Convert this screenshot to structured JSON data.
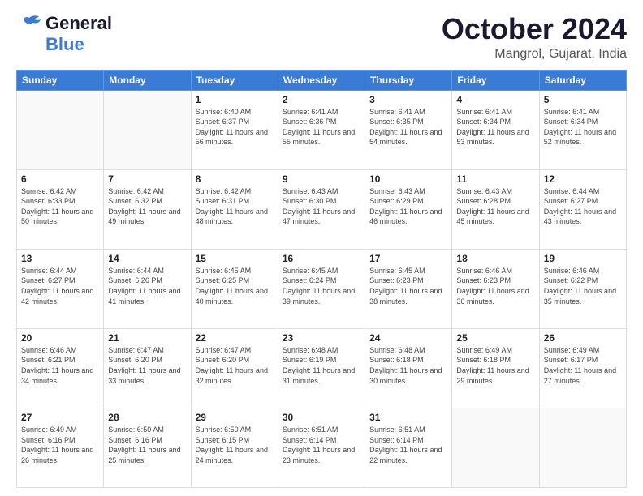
{
  "header": {
    "logo": {
      "line1": "General",
      "line2": "Blue"
    },
    "title": "October 2024",
    "location": "Mangrol, Gujarat, India"
  },
  "weekdays": [
    "Sunday",
    "Monday",
    "Tuesday",
    "Wednesday",
    "Thursday",
    "Friday",
    "Saturday"
  ],
  "weeks": [
    [
      {
        "day": "",
        "info": ""
      },
      {
        "day": "",
        "info": ""
      },
      {
        "day": "1",
        "sunrise": "6:40 AM",
        "sunset": "6:37 PM",
        "daylight": "11 hours and 56 minutes."
      },
      {
        "day": "2",
        "sunrise": "6:41 AM",
        "sunset": "6:36 PM",
        "daylight": "11 hours and 55 minutes."
      },
      {
        "day": "3",
        "sunrise": "6:41 AM",
        "sunset": "6:35 PM",
        "daylight": "11 hours and 54 minutes."
      },
      {
        "day": "4",
        "sunrise": "6:41 AM",
        "sunset": "6:34 PM",
        "daylight": "11 hours and 53 minutes."
      },
      {
        "day": "5",
        "sunrise": "6:41 AM",
        "sunset": "6:34 PM",
        "daylight": "11 hours and 52 minutes."
      }
    ],
    [
      {
        "day": "6",
        "sunrise": "6:42 AM",
        "sunset": "6:33 PM",
        "daylight": "11 hours and 50 minutes."
      },
      {
        "day": "7",
        "sunrise": "6:42 AM",
        "sunset": "6:32 PM",
        "daylight": "11 hours and 49 minutes."
      },
      {
        "day": "8",
        "sunrise": "6:42 AM",
        "sunset": "6:31 PM",
        "daylight": "11 hours and 48 minutes."
      },
      {
        "day": "9",
        "sunrise": "6:43 AM",
        "sunset": "6:30 PM",
        "daylight": "11 hours and 47 minutes."
      },
      {
        "day": "10",
        "sunrise": "6:43 AM",
        "sunset": "6:29 PM",
        "daylight": "11 hours and 46 minutes."
      },
      {
        "day": "11",
        "sunrise": "6:43 AM",
        "sunset": "6:28 PM",
        "daylight": "11 hours and 45 minutes."
      },
      {
        "day": "12",
        "sunrise": "6:44 AM",
        "sunset": "6:27 PM",
        "daylight": "11 hours and 43 minutes."
      }
    ],
    [
      {
        "day": "13",
        "sunrise": "6:44 AM",
        "sunset": "6:27 PM",
        "daylight": "11 hours and 42 minutes."
      },
      {
        "day": "14",
        "sunrise": "6:44 AM",
        "sunset": "6:26 PM",
        "daylight": "11 hours and 41 minutes."
      },
      {
        "day": "15",
        "sunrise": "6:45 AM",
        "sunset": "6:25 PM",
        "daylight": "11 hours and 40 minutes."
      },
      {
        "day": "16",
        "sunrise": "6:45 AM",
        "sunset": "6:24 PM",
        "daylight": "11 hours and 39 minutes."
      },
      {
        "day": "17",
        "sunrise": "6:45 AM",
        "sunset": "6:23 PM",
        "daylight": "11 hours and 38 minutes."
      },
      {
        "day": "18",
        "sunrise": "6:46 AM",
        "sunset": "6:23 PM",
        "daylight": "11 hours and 36 minutes."
      },
      {
        "day": "19",
        "sunrise": "6:46 AM",
        "sunset": "6:22 PM",
        "daylight": "11 hours and 35 minutes."
      }
    ],
    [
      {
        "day": "20",
        "sunrise": "6:46 AM",
        "sunset": "6:21 PM",
        "daylight": "11 hours and 34 minutes."
      },
      {
        "day": "21",
        "sunrise": "6:47 AM",
        "sunset": "6:20 PM",
        "daylight": "11 hours and 33 minutes."
      },
      {
        "day": "22",
        "sunrise": "6:47 AM",
        "sunset": "6:20 PM",
        "daylight": "11 hours and 32 minutes."
      },
      {
        "day": "23",
        "sunrise": "6:48 AM",
        "sunset": "6:19 PM",
        "daylight": "11 hours and 31 minutes."
      },
      {
        "day": "24",
        "sunrise": "6:48 AM",
        "sunset": "6:18 PM",
        "daylight": "11 hours and 30 minutes."
      },
      {
        "day": "25",
        "sunrise": "6:49 AM",
        "sunset": "6:18 PM",
        "daylight": "11 hours and 29 minutes."
      },
      {
        "day": "26",
        "sunrise": "6:49 AM",
        "sunset": "6:17 PM",
        "daylight": "11 hours and 27 minutes."
      }
    ],
    [
      {
        "day": "27",
        "sunrise": "6:49 AM",
        "sunset": "6:16 PM",
        "daylight": "11 hours and 26 minutes."
      },
      {
        "day": "28",
        "sunrise": "6:50 AM",
        "sunset": "6:16 PM",
        "daylight": "11 hours and 25 minutes."
      },
      {
        "day": "29",
        "sunrise": "6:50 AM",
        "sunset": "6:15 PM",
        "daylight": "11 hours and 24 minutes."
      },
      {
        "day": "30",
        "sunrise": "6:51 AM",
        "sunset": "6:14 PM",
        "daylight": "11 hours and 23 minutes."
      },
      {
        "day": "31",
        "sunrise": "6:51 AM",
        "sunset": "6:14 PM",
        "daylight": "11 hours and 22 minutes."
      },
      {
        "day": "",
        "info": ""
      },
      {
        "day": "",
        "info": ""
      }
    ]
  ]
}
